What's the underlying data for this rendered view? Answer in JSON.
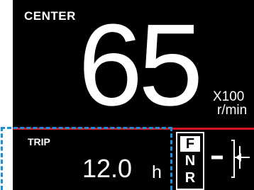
{
  "display": {
    "mode_label": "CENTER",
    "rpm_value": "65",
    "unit_multiplier": "X100",
    "unit_rpm": "r/min",
    "trip_label": "TRIP",
    "trip_value": "12.0",
    "trip_unit": "h",
    "gear_positions": [
      "F",
      "N",
      "R"
    ],
    "active_gear": "F"
  },
  "colors": {
    "background": "#000000",
    "text": "#ffffff",
    "divider": "#d8141e",
    "highlight_dash": "#1a8fd8"
  }
}
